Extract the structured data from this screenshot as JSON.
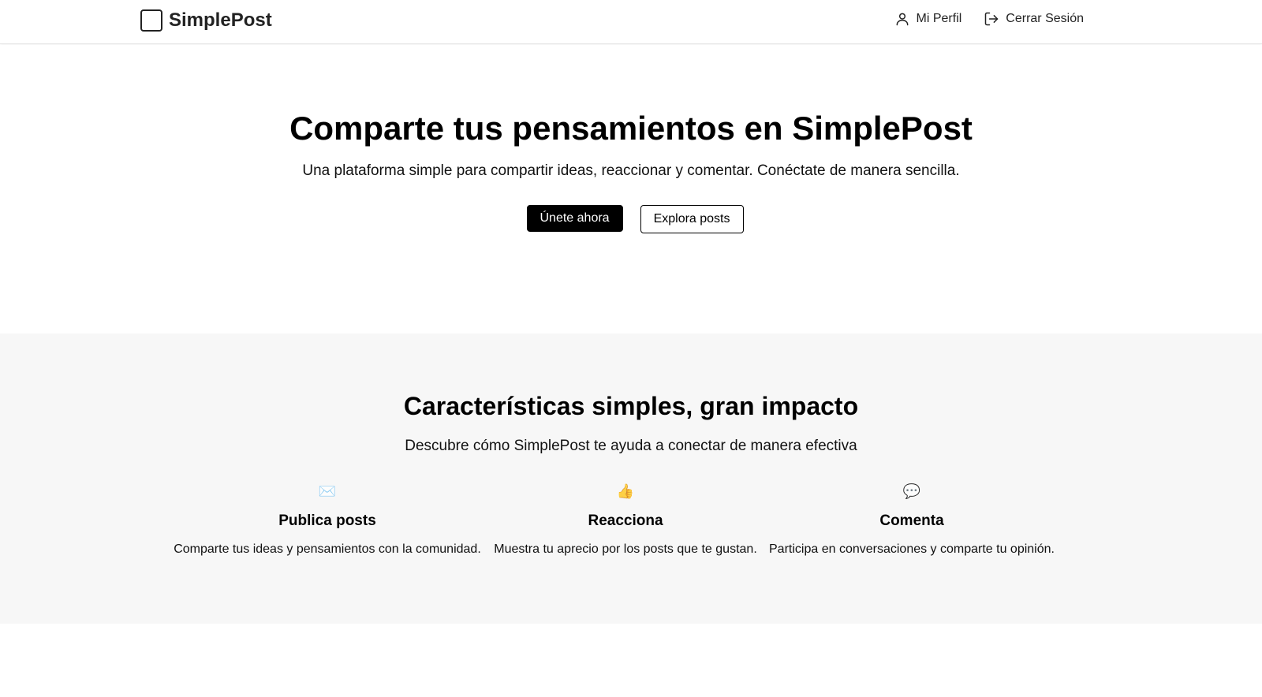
{
  "navbar": {
    "brand": "SimplePost",
    "links": [
      {
        "label": "Mi Perfil",
        "icon": "user-icon"
      },
      {
        "label": "Cerrar Sesión",
        "icon": "logout-icon"
      }
    ]
  },
  "hero": {
    "title": "Comparte tus pensamientos en SimplePost",
    "subtitle": "Una plataforma simple para compartir ideas, reaccionar y comentar. Conéctate de manera sencilla.",
    "primary_button": "Únete ahora",
    "secondary_button": "Explora posts"
  },
  "features": {
    "title": "Características simples, gran impacto",
    "subtitle": "Descubre cómo SimplePost te ayuda a conectar de manera efectiva",
    "items": [
      {
        "icon": "✉️",
        "title": "Publica posts",
        "description": "Comparte tus ideas y pensamientos con la comunidad."
      },
      {
        "icon": "👍",
        "title": "Reacciona",
        "description": "Muestra tu aprecio por los posts que te gustan."
      },
      {
        "icon": "💬",
        "title": "Comenta",
        "description": "Participa en conversaciones y comparte tu opinión."
      }
    ]
  },
  "colors": {
    "primary": "#000000",
    "section_bg": "#f7f7f7"
  }
}
